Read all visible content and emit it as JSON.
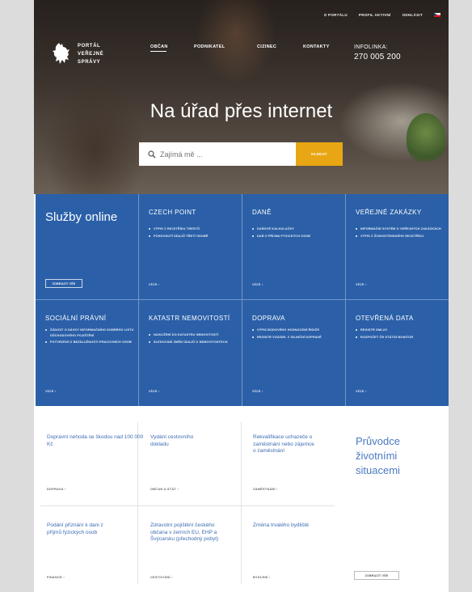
{
  "utility_nav": {
    "items": [
      "O PORTÁLU",
      "PROFIL AKTIVNÍ",
      "ODHLÁSIT"
    ]
  },
  "logo": {
    "lines": [
      "PORTÁL",
      "VEŘEJNÉ",
      "SPRÁVY"
    ]
  },
  "main_nav": {
    "items": [
      "OBČAN",
      "PODNIKATEL",
      "CIZINEC",
      "KONTAKTY"
    ],
    "active": "OBČAN"
  },
  "infoline": {
    "label": "INFOLINKA:",
    "phone": "270 005 200"
  },
  "hero": {
    "headline": "Na úřad přes internet"
  },
  "search": {
    "placeholder": "Zajímá mě ...",
    "button": "HLEDAT"
  },
  "colors": {
    "accent": "#e8a614",
    "grid_blue": "#2b60a8",
    "link_blue": "#3d6db2"
  },
  "services": {
    "online": {
      "title": "Služby online",
      "button": "ZOBRAZIT VŠE"
    },
    "cells": [
      {
        "title": "CZECH POINT",
        "items": [
          "VÝPIS Z REJSTŘÍKU TRESTŮ",
          "PONOVNUTÍ ÚDAJŮ TŘETÍ OSOBĚ"
        ],
        "more": "VÍCE"
      },
      {
        "title": "DANĚ",
        "items": [
          "DAŇOVÉ KALKULAČKY",
          "DAŇ Z PŘÍJMU FYZICKÝCH OSOB"
        ],
        "more": "VÍCE"
      },
      {
        "title": "VEŘEJNÉ ZAKÁZKY",
        "items": [
          "INFORMAČNÍ SYSTÉM O VEŘEJNÝCH ZAKÁZKÁCH",
          "VÝPIS Z ŽIVNOSTENSKÉHO REJSTŘÍKU"
        ],
        "more": "VÍCE"
      },
      {
        "title": "SOCIÁLNÍ PRÁVNÍ",
        "items": [
          "ŽÁDOST O DÁVKY INFORMAČNÍHO DOBRÉHO LISTU DŮCHODOVÉHO POJIŠTĚNÍ",
          "POTVRZENÍ O BEZDLUŽNOSTI PRACOVNÍCH OSOB"
        ],
        "more": "VÍCE"
      },
      {
        "title": "KATASTR NEMOVITOSTÍ",
        "items": [
          "NAHLÍŽENÍ DO KATASTRU NEMOVITOSTÍ",
          "SLEDOVÁNÍ ZMĚN ÚDAJŮ O NEMOVITOSTECH"
        ],
        "more": "VÍCE"
      },
      {
        "title": "DOPRAVA",
        "items": [
          "VÝPIS BODOVÉHO HODNOCENÍ ŘIDIČE",
          "REGISTR VOZIDEL V SILNIČNÍ DOPRAVĚ"
        ],
        "more": "VÍCE"
      },
      {
        "title": "OTEVŘENÁ DATA",
        "items": [
          "REGISTR SMLUV",
          "ROZPOČET ČR STÁTNÍ MONITOR"
        ],
        "more": "VÍCE"
      }
    ]
  },
  "situations": [
    {
      "title": "Dopravní nehoda se škodou nad 100 000 Kč",
      "category": "DOPRAVA"
    },
    {
      "title": "Vydání cestovního dokladu",
      "category": "OBČAN A STÁT"
    },
    {
      "title": "Rekvalifikace uchazeče o zaměstnání nebo zájemce o zaměstnání",
      "category": "ZAMĚSTNÁNÍ"
    },
    {
      "title": "Podání přiznání k dani z příjmů fyzických osob",
      "category": "FINANCE"
    },
    {
      "title": "Zdravotní pojištění českého občana v zemích EU, EHP a Švýcarsku (přechodný pobyt)",
      "category": "CESTOVÁNÍ"
    },
    {
      "title": "Změna trvalého bydliště",
      "category": "BYDLENÍ"
    }
  ],
  "guide": {
    "title": "Průvodce životními situacemi",
    "button": "ZOBRAZIT VŠE"
  }
}
